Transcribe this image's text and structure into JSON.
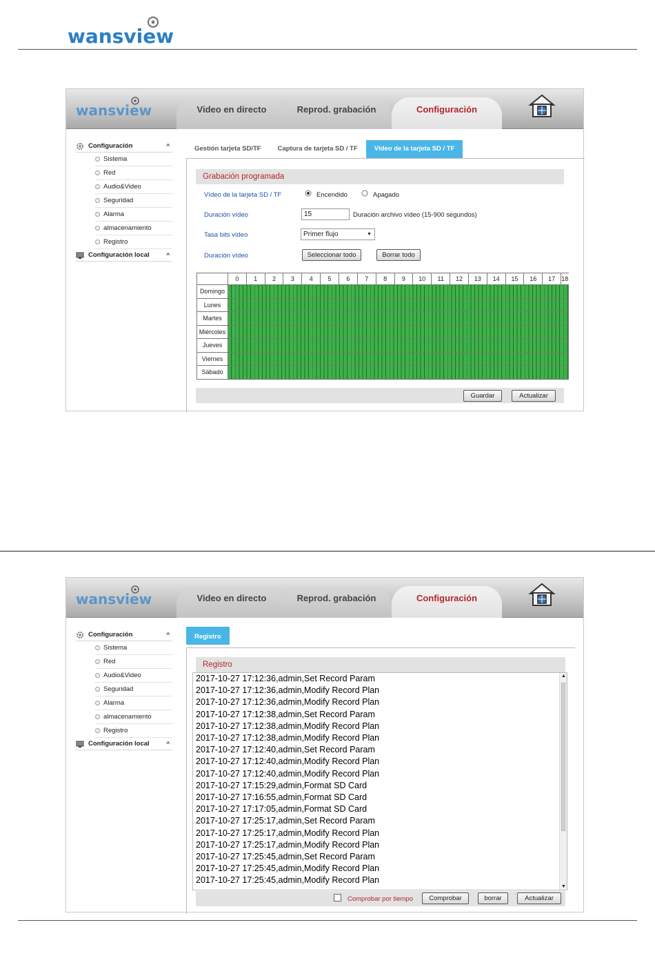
{
  "brand": "wansview",
  "top_tabs": [
    "Video en directo",
    "Reprod. grabación",
    "Configuración"
  ],
  "sidebar": {
    "head": "Configuración",
    "items": [
      "Sistema",
      "Red",
      "Audio&Video",
      "Seguridad",
      "Alarma",
      "almacenamiento",
      "Registro"
    ],
    "local": "Configuración local"
  },
  "shot1": {
    "subtabs": [
      "Gestión tarjeta SD/TF",
      "Captura de tarjeta SD / TF",
      "Vídeo de la tarjeta SD / TF"
    ],
    "panel_title": "Grabación programada",
    "rows": {
      "sd_video_label": "Vídeo de la tarjeta SD / TF",
      "on_label": "Encendido",
      "off_label": "Apagado",
      "duration_label": "Duración vídeo",
      "duration_value": "15",
      "duration_hint": "Duración archivo vídeo (15-900 segundos)",
      "bitrate_label": "Tasa bits vídeo",
      "bitrate_value": "Primer flujo",
      "duration2_label": "Duración vídeo",
      "select_all": "Seleccionar todo",
      "clear_all": "Borrar todo"
    },
    "hours": [
      "0",
      "1",
      "2",
      "3",
      "4",
      "5",
      "6",
      "7",
      "8",
      "9",
      "10",
      "11",
      "12",
      "13",
      "14",
      "15",
      "16",
      "17",
      "18"
    ],
    "days": [
      "Domingo",
      "Lunes",
      "Martes",
      "Miércoles",
      "Jueves",
      "Viernes",
      "Sábado"
    ],
    "save": "Guardar",
    "refresh": "Actualizar"
  },
  "shot2": {
    "subtab": "Registro",
    "panel_title": "Registro",
    "log": [
      "2017-10-27 17:12:36,admin,Set Record Param",
      "2017-10-27 17:12:36,admin,Modify Record Plan",
      "2017-10-27 17:12:36,admin,Modify Record Plan",
      "2017-10-27 17:12:38,admin,Set Record Param",
      "2017-10-27 17:12:38,admin,Modify Record Plan",
      "2017-10-27 17:12:38,admin,Modify Record Plan",
      "2017-10-27 17:12:40,admin,Set Record Param",
      "2017-10-27 17:12:40,admin,Modify Record Plan",
      "2017-10-27 17:12:40,admin,Modify Record Plan",
      "2017-10-27 17:15:29,admin,Format SD Card",
      "2017-10-27 17:16:55,admin,Format SD Card",
      "2017-10-27 17:17:05,admin,Format SD Card",
      "2017-10-27 17:25:17,admin,Set Record Param",
      "2017-10-27 17:25:17,admin,Modify Record Plan",
      "2017-10-27 17:25:17,admin,Modify Record Plan",
      "2017-10-27 17:25:45,admin,Set Record Param",
      "2017-10-27 17:25:45,admin,Modify Record Plan",
      "2017-10-27 17:25:45,admin,Modify Record Plan"
    ],
    "check_label": "Comprobar por tiempo",
    "check_button": "Comprobar",
    "delete_button": "borrar",
    "refresh_button": "Actualizar"
  }
}
